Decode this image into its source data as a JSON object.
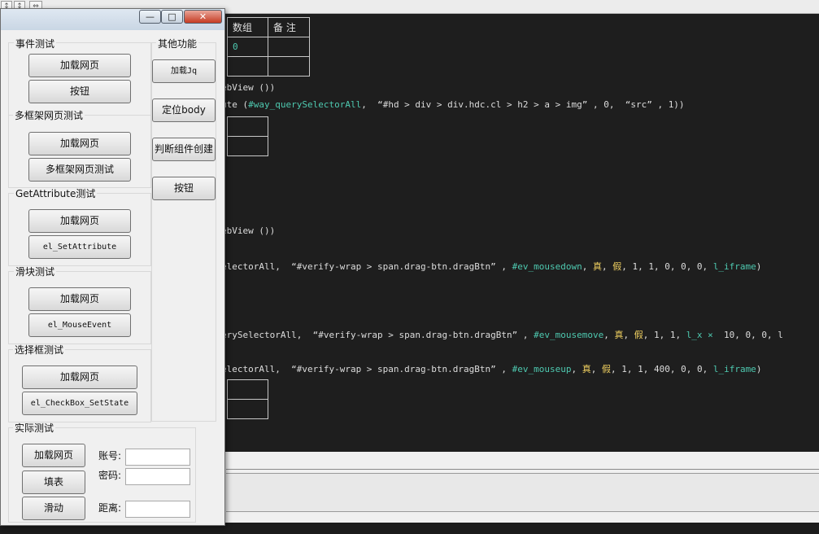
{
  "ide": {
    "toolbar_icons": [
      "↕",
      "↕",
      "⇔"
    ],
    "table_top": {
      "headers": [
        "数组",
        "备 注"
      ],
      "row1": [
        "0",
        ""
      ],
      "row2": [
        "",
        ""
      ]
    },
    "code_lines": [
      {
        "text": "ebView ())"
      },
      {
        "parts": [
          {
            "t": "ute (",
            "c": "cmd"
          },
          {
            "t": "#way_querySelectorAll",
            "c": "const"
          },
          {
            "t": ",  “#hd > div > div.hdc.cl > h2 > a > img” , 0,  “src” , 1))",
            "c": "str"
          }
        ]
      },
      {
        "text": "ebView ())"
      },
      {
        "parts": [
          {
            "t": "electorAll,  “#verify-wrap > span.drag-btn.dragBtn” , ",
            "c": "str"
          },
          {
            "t": "#ev_mousedown",
            "c": "const"
          },
          {
            "t": ", ",
            "c": "str"
          },
          {
            "t": "真",
            "c": "kw"
          },
          {
            "t": ", ",
            "c": "str"
          },
          {
            "t": "假",
            "c": "kw"
          },
          {
            "t": ", 1, 1, 0, 0, 0, ",
            "c": "str"
          },
          {
            "t": "l_iframe",
            "c": "var"
          },
          {
            "t": ")",
            "c": "str"
          }
        ]
      },
      {
        "parts": [
          {
            "t": "erySelectorAll,  “#verify-wrap > span.drag-btn.dragBtn” , ",
            "c": "str"
          },
          {
            "t": "#ev_mousemove",
            "c": "const"
          },
          {
            "t": ", ",
            "c": "str"
          },
          {
            "t": "真",
            "c": "kw"
          },
          {
            "t": ", ",
            "c": "str"
          },
          {
            "t": "假",
            "c": "kw"
          },
          {
            "t": ", 1, 1, ",
            "c": "str"
          },
          {
            "t": "l_x",
            "c": "var"
          },
          {
            "t": " × ",
            "c": "const"
          },
          {
            "t": " 10, 0, 0, l",
            "c": "str"
          }
        ]
      },
      {
        "parts": [
          {
            "t": "electorAll,  “#verify-wrap > span.drag-btn.dragBtn” , ",
            "c": "str"
          },
          {
            "t": "#ev_mouseup",
            "c": "const"
          },
          {
            "t": ", ",
            "c": "str"
          },
          {
            "t": "真",
            "c": "kw"
          },
          {
            "t": ", ",
            "c": "str"
          },
          {
            "t": "假",
            "c": "kw"
          },
          {
            "t": ", 1, 1, 400, 0, 0, ",
            "c": "str"
          },
          {
            "t": "l_iframe",
            "c": "var"
          },
          {
            "t": ")",
            "c": "str"
          }
        ]
      }
    ]
  },
  "window": {
    "controls": {
      "minimize": "—",
      "maximize": "□",
      "close": "✕"
    },
    "groups": {
      "event_test": {
        "label": "事件测试",
        "load": "加载网页",
        "button": "按钮"
      },
      "multiframe_test": {
        "label": "多框架网页测试",
        "load": "加载网页",
        "button": "多框架网页测试"
      },
      "getattr_test": {
        "label": "GetAttribute测试",
        "load": "加载网页",
        "button": "el_SetAttribute"
      },
      "slider_test": {
        "label": "滑块测试",
        "load": "加载网页",
        "button": "el_MouseEvent"
      },
      "checkbox_test": {
        "label": "选择框测试",
        "load": "加载网页",
        "button": "el_CheckBox_SetState"
      },
      "other": {
        "label": "其他功能",
        "load_jq": "加载Jq",
        "locate_body": "定位body",
        "check_created": "判断组件创建",
        "button": "按钮"
      },
      "actual_test": {
        "label": "实际测试",
        "load": "加载网页",
        "fill": "填表",
        "slide": "滑动",
        "account_label": "账号:",
        "password_label": "密码:",
        "distance_label": "距离:",
        "account_value": "",
        "password_value": "",
        "distance_value": ""
      }
    }
  }
}
